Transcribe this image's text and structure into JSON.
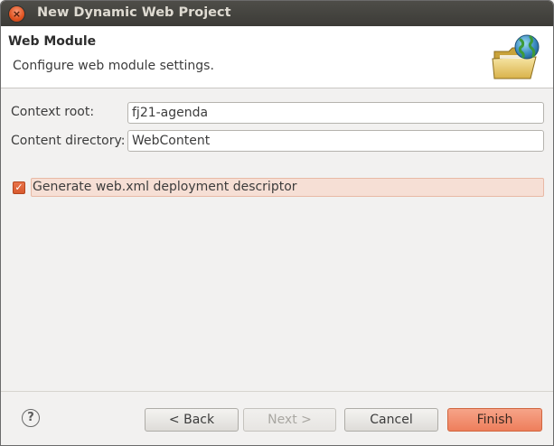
{
  "window": {
    "title": "New Dynamic Web Project",
    "close_glyph": "×"
  },
  "banner": {
    "title": "Web Module",
    "description": "Configure web module settings.",
    "icon": "folder-globe-icon"
  },
  "form": {
    "context_root": {
      "label": "Context root:",
      "value": "fj21-agenda"
    },
    "content_directory": {
      "label": "Content directory:",
      "value": "WebContent"
    },
    "generate_descriptor": {
      "label": "Generate web.xml deployment descriptor",
      "checked": true,
      "check_glyph": "✓"
    }
  },
  "footer": {
    "help_glyph": "?",
    "back_label": "< Back",
    "next_label": "Next >",
    "cancel_label": "Cancel",
    "finish_label": "Finish"
  },
  "colors": {
    "accent": "#ee7e5b",
    "titlebar": "#3c3b37",
    "selection": "#f6dfd5"
  }
}
